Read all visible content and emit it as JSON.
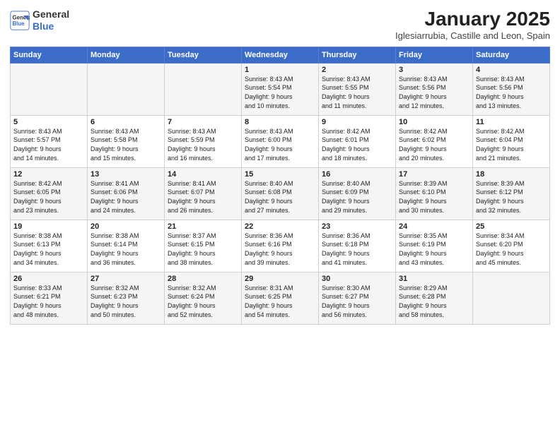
{
  "logo": {
    "line1": "General",
    "line2": "Blue"
  },
  "title": "January 2025",
  "subtitle": "Iglesiarrubia, Castille and Leon, Spain",
  "days_of_week": [
    "Sunday",
    "Monday",
    "Tuesday",
    "Wednesday",
    "Thursday",
    "Friday",
    "Saturday"
  ],
  "weeks": [
    [
      {
        "day": "",
        "info": ""
      },
      {
        "day": "",
        "info": ""
      },
      {
        "day": "",
        "info": ""
      },
      {
        "day": "1",
        "info": "Sunrise: 8:43 AM\nSunset: 5:54 PM\nDaylight: 9 hours\nand 10 minutes."
      },
      {
        "day": "2",
        "info": "Sunrise: 8:43 AM\nSunset: 5:55 PM\nDaylight: 9 hours\nand 11 minutes."
      },
      {
        "day": "3",
        "info": "Sunrise: 8:43 AM\nSunset: 5:56 PM\nDaylight: 9 hours\nand 12 minutes."
      },
      {
        "day": "4",
        "info": "Sunrise: 8:43 AM\nSunset: 5:56 PM\nDaylight: 9 hours\nand 13 minutes."
      }
    ],
    [
      {
        "day": "5",
        "info": "Sunrise: 8:43 AM\nSunset: 5:57 PM\nDaylight: 9 hours\nand 14 minutes."
      },
      {
        "day": "6",
        "info": "Sunrise: 8:43 AM\nSunset: 5:58 PM\nDaylight: 9 hours\nand 15 minutes."
      },
      {
        "day": "7",
        "info": "Sunrise: 8:43 AM\nSunset: 5:59 PM\nDaylight: 9 hours\nand 16 minutes."
      },
      {
        "day": "8",
        "info": "Sunrise: 8:43 AM\nSunset: 6:00 PM\nDaylight: 9 hours\nand 17 minutes."
      },
      {
        "day": "9",
        "info": "Sunrise: 8:42 AM\nSunset: 6:01 PM\nDaylight: 9 hours\nand 18 minutes."
      },
      {
        "day": "10",
        "info": "Sunrise: 8:42 AM\nSunset: 6:02 PM\nDaylight: 9 hours\nand 20 minutes."
      },
      {
        "day": "11",
        "info": "Sunrise: 8:42 AM\nSunset: 6:04 PM\nDaylight: 9 hours\nand 21 minutes."
      }
    ],
    [
      {
        "day": "12",
        "info": "Sunrise: 8:42 AM\nSunset: 6:05 PM\nDaylight: 9 hours\nand 23 minutes."
      },
      {
        "day": "13",
        "info": "Sunrise: 8:41 AM\nSunset: 6:06 PM\nDaylight: 9 hours\nand 24 minutes."
      },
      {
        "day": "14",
        "info": "Sunrise: 8:41 AM\nSunset: 6:07 PM\nDaylight: 9 hours\nand 26 minutes."
      },
      {
        "day": "15",
        "info": "Sunrise: 8:40 AM\nSunset: 6:08 PM\nDaylight: 9 hours\nand 27 minutes."
      },
      {
        "day": "16",
        "info": "Sunrise: 8:40 AM\nSunset: 6:09 PM\nDaylight: 9 hours\nand 29 minutes."
      },
      {
        "day": "17",
        "info": "Sunrise: 8:39 AM\nSunset: 6:10 PM\nDaylight: 9 hours\nand 30 minutes."
      },
      {
        "day": "18",
        "info": "Sunrise: 8:39 AM\nSunset: 6:12 PM\nDaylight: 9 hours\nand 32 minutes."
      }
    ],
    [
      {
        "day": "19",
        "info": "Sunrise: 8:38 AM\nSunset: 6:13 PM\nDaylight: 9 hours\nand 34 minutes."
      },
      {
        "day": "20",
        "info": "Sunrise: 8:38 AM\nSunset: 6:14 PM\nDaylight: 9 hours\nand 36 minutes."
      },
      {
        "day": "21",
        "info": "Sunrise: 8:37 AM\nSunset: 6:15 PM\nDaylight: 9 hours\nand 38 minutes."
      },
      {
        "day": "22",
        "info": "Sunrise: 8:36 AM\nSunset: 6:16 PM\nDaylight: 9 hours\nand 39 minutes."
      },
      {
        "day": "23",
        "info": "Sunrise: 8:36 AM\nSunset: 6:18 PM\nDaylight: 9 hours\nand 41 minutes."
      },
      {
        "day": "24",
        "info": "Sunrise: 8:35 AM\nSunset: 6:19 PM\nDaylight: 9 hours\nand 43 minutes."
      },
      {
        "day": "25",
        "info": "Sunrise: 8:34 AM\nSunset: 6:20 PM\nDaylight: 9 hours\nand 45 minutes."
      }
    ],
    [
      {
        "day": "26",
        "info": "Sunrise: 8:33 AM\nSunset: 6:21 PM\nDaylight: 9 hours\nand 48 minutes."
      },
      {
        "day": "27",
        "info": "Sunrise: 8:32 AM\nSunset: 6:23 PM\nDaylight: 9 hours\nand 50 minutes."
      },
      {
        "day": "28",
        "info": "Sunrise: 8:32 AM\nSunset: 6:24 PM\nDaylight: 9 hours\nand 52 minutes."
      },
      {
        "day": "29",
        "info": "Sunrise: 8:31 AM\nSunset: 6:25 PM\nDaylight: 9 hours\nand 54 minutes."
      },
      {
        "day": "30",
        "info": "Sunrise: 8:30 AM\nSunset: 6:27 PM\nDaylight: 9 hours\nand 56 minutes."
      },
      {
        "day": "31",
        "info": "Sunrise: 8:29 AM\nSunset: 6:28 PM\nDaylight: 9 hours\nand 58 minutes."
      },
      {
        "day": "",
        "info": ""
      }
    ]
  ]
}
